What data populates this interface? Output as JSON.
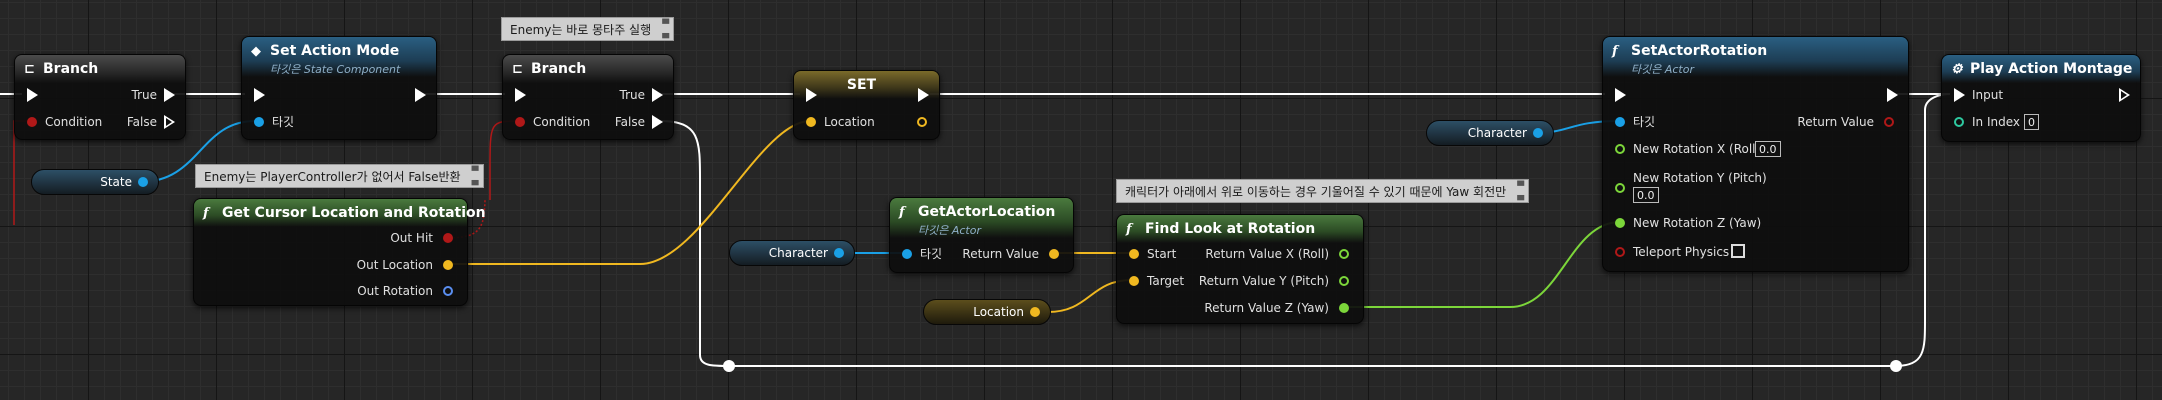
{
  "comments": {
    "branch2": "Enemy는 바로 몽타주 실행",
    "cursor": "Enemy는 PlayerController가 없어서 False반환",
    "lookat": "캐릭터가 아래에서 위로 이동하는 경우 기울어질 수 있기 때문에 Yaw 회전만"
  },
  "branch1": {
    "title": "Branch",
    "true": "True",
    "false": "False",
    "condition": "Condition"
  },
  "set_action_mode": {
    "title": "Set Action Mode",
    "subtitle": "타깃은 State Component",
    "target": "타깃"
  },
  "branch2": {
    "title": "Branch",
    "true": "True",
    "false": "False",
    "condition": "Condition"
  },
  "set_node": {
    "title": "SET",
    "location": "Location"
  },
  "get_cursor": {
    "title": "Get Cursor Location and Rotation",
    "out_hit": "Out Hit",
    "out_location": "Out Location",
    "out_rotation": "Out Rotation"
  },
  "get_actor_location": {
    "title": "GetActorLocation",
    "subtitle": "타깃은 Actor",
    "target": "타깃",
    "return_value": "Return Value"
  },
  "find_look_at": {
    "title": "Find Look at Rotation",
    "start": "Start",
    "target": "Target",
    "rx": "Return Value X (Roll)",
    "ry": "Return Value Y (Pitch)",
    "rz": "Return Value Z (Yaw)"
  },
  "set_actor_rotation": {
    "title": "SetActorRotation",
    "subtitle": "타깃은 Actor",
    "target": "타깃",
    "return_value": "Return Value",
    "new_x": "New Rotation X (Roll)",
    "new_x_val": "0.0",
    "new_y": "New Rotation Y (Pitch)",
    "new_y_val": "0.0",
    "new_z": "New Rotation Z (Yaw)",
    "teleport": "Teleport Physics",
    "teleport_checked": false
  },
  "play_montage": {
    "title": "Play Action Montage",
    "input": "Input",
    "in_index": "In Index",
    "in_index_val": "0"
  },
  "vars": {
    "state": "State",
    "character1": "Character",
    "character2": "Character",
    "location": "Location"
  },
  "colors": {
    "exec": "#ffffff",
    "object": "#1aa0e6",
    "vector": "#f0b820",
    "float": "#7cd63a",
    "bool": "#b01818",
    "int": "#2ec9a0"
  }
}
